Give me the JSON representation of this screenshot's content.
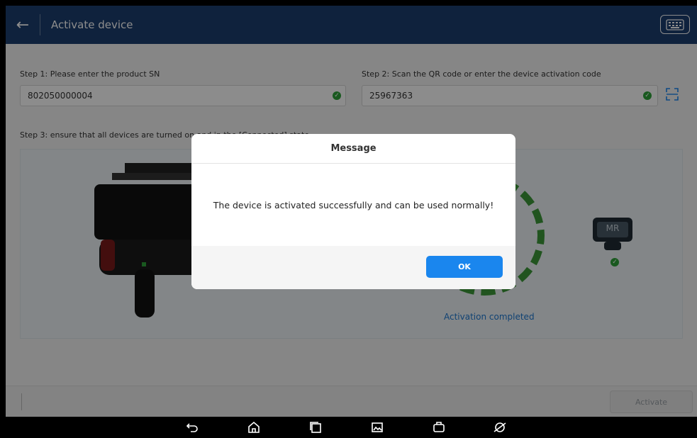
{
  "header": {
    "title": "Activate device"
  },
  "step1": {
    "label": "Step 1: Please enter the product SN",
    "value": "802050000004"
  },
  "step2": {
    "label": "Step 2: Scan the QR code or enter the device activation code",
    "value": "25967363"
  },
  "step3": {
    "label": "Step 3: ensure that all devices are turned on and in the [Connected] state"
  },
  "device": {
    "mr_label": "MR",
    "status": "Activation completed"
  },
  "dialog": {
    "title": "Message",
    "message": "The device is activated successfully and can be used normally!",
    "ok_label": "OK"
  },
  "footer": {
    "activate_label": "Activate"
  },
  "colors": {
    "header_bg": "#1d3e6f",
    "accent": "#1a86ee",
    "success": "#2fa33a"
  },
  "icons": {
    "back": "arrow-left-icon",
    "vci": "keyboard-icon",
    "scan": "qr-scan-icon",
    "nav": [
      "back-icon",
      "home-icon",
      "recents-icon",
      "screenshot-icon",
      "vci-icon",
      "browser-icon"
    ]
  }
}
